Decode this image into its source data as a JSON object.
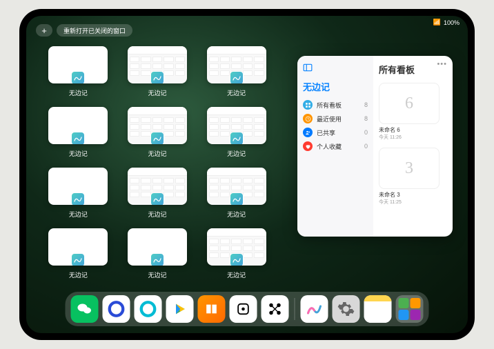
{
  "status": {
    "battery": "100%",
    "signal": "●●●●"
  },
  "topControls": {
    "plusLabel": "+",
    "recentLabel": "重新打开已关闭的窗口"
  },
  "windows": [
    {
      "label": "无边记",
      "variant": "blank"
    },
    {
      "label": "无边记",
      "variant": "calendar"
    },
    {
      "label": "无边记",
      "variant": "calendar"
    },
    {
      "label": "无边记",
      "variant": "blank"
    },
    {
      "label": "无边记",
      "variant": "calendar"
    },
    {
      "label": "无边记",
      "variant": "calendar"
    },
    {
      "label": "无边记",
      "variant": "blank"
    },
    {
      "label": "无边记",
      "variant": "calendar"
    },
    {
      "label": "无边记",
      "variant": "calendar"
    },
    {
      "label": "无边记",
      "variant": "blank"
    },
    {
      "label": "无边记",
      "variant": "blank"
    },
    {
      "label": "无边记",
      "variant": "calendar"
    }
  ],
  "sidebar": {
    "leftTitle": "无边记",
    "rightTitle": "所有看板",
    "items": [
      {
        "icon": "grid",
        "color": "#32ade6",
        "label": "所有看板",
        "count": "8"
      },
      {
        "icon": "clock",
        "color": "#ff9500",
        "label": "最近使用",
        "count": "8"
      },
      {
        "icon": "people",
        "color": "#007aff",
        "label": "已共享",
        "count": "0"
      },
      {
        "icon": "heart",
        "color": "#ff3b30",
        "label": "个人收藏",
        "count": "0"
      }
    ],
    "boards": [
      {
        "sketch": "6",
        "label": "未命名 6",
        "sub": "今天 11:26"
      },
      {
        "sketch": "3",
        "label": "未命名 3",
        "sub": "今天 11:25"
      }
    ]
  },
  "dock": {
    "apps": [
      {
        "name": "wechat",
        "bg": "#07c160",
        "glyph": "wechat"
      },
      {
        "name": "quark-hd",
        "bg": "#fff",
        "glyph": "quark-blue"
      },
      {
        "name": "quark",
        "bg": "#fff",
        "glyph": "quark-cyan"
      },
      {
        "name": "play",
        "bg": "#fff",
        "glyph": "play"
      },
      {
        "name": "books",
        "bg": "linear-gradient(135deg,#ff9500,#ff6a00)",
        "glyph": "books"
      },
      {
        "name": "dice",
        "bg": "#fff",
        "glyph": "dice"
      },
      {
        "name": "connect",
        "bg": "#fff",
        "glyph": "nodes"
      }
    ],
    "recent": [
      {
        "name": "freeform",
        "bg": "#fff",
        "glyph": "freeform"
      },
      {
        "name": "settings",
        "bg": "#d8d8d8",
        "glyph": "gear"
      },
      {
        "name": "notes",
        "bg": "#fff",
        "glyph": "notes"
      }
    ]
  }
}
